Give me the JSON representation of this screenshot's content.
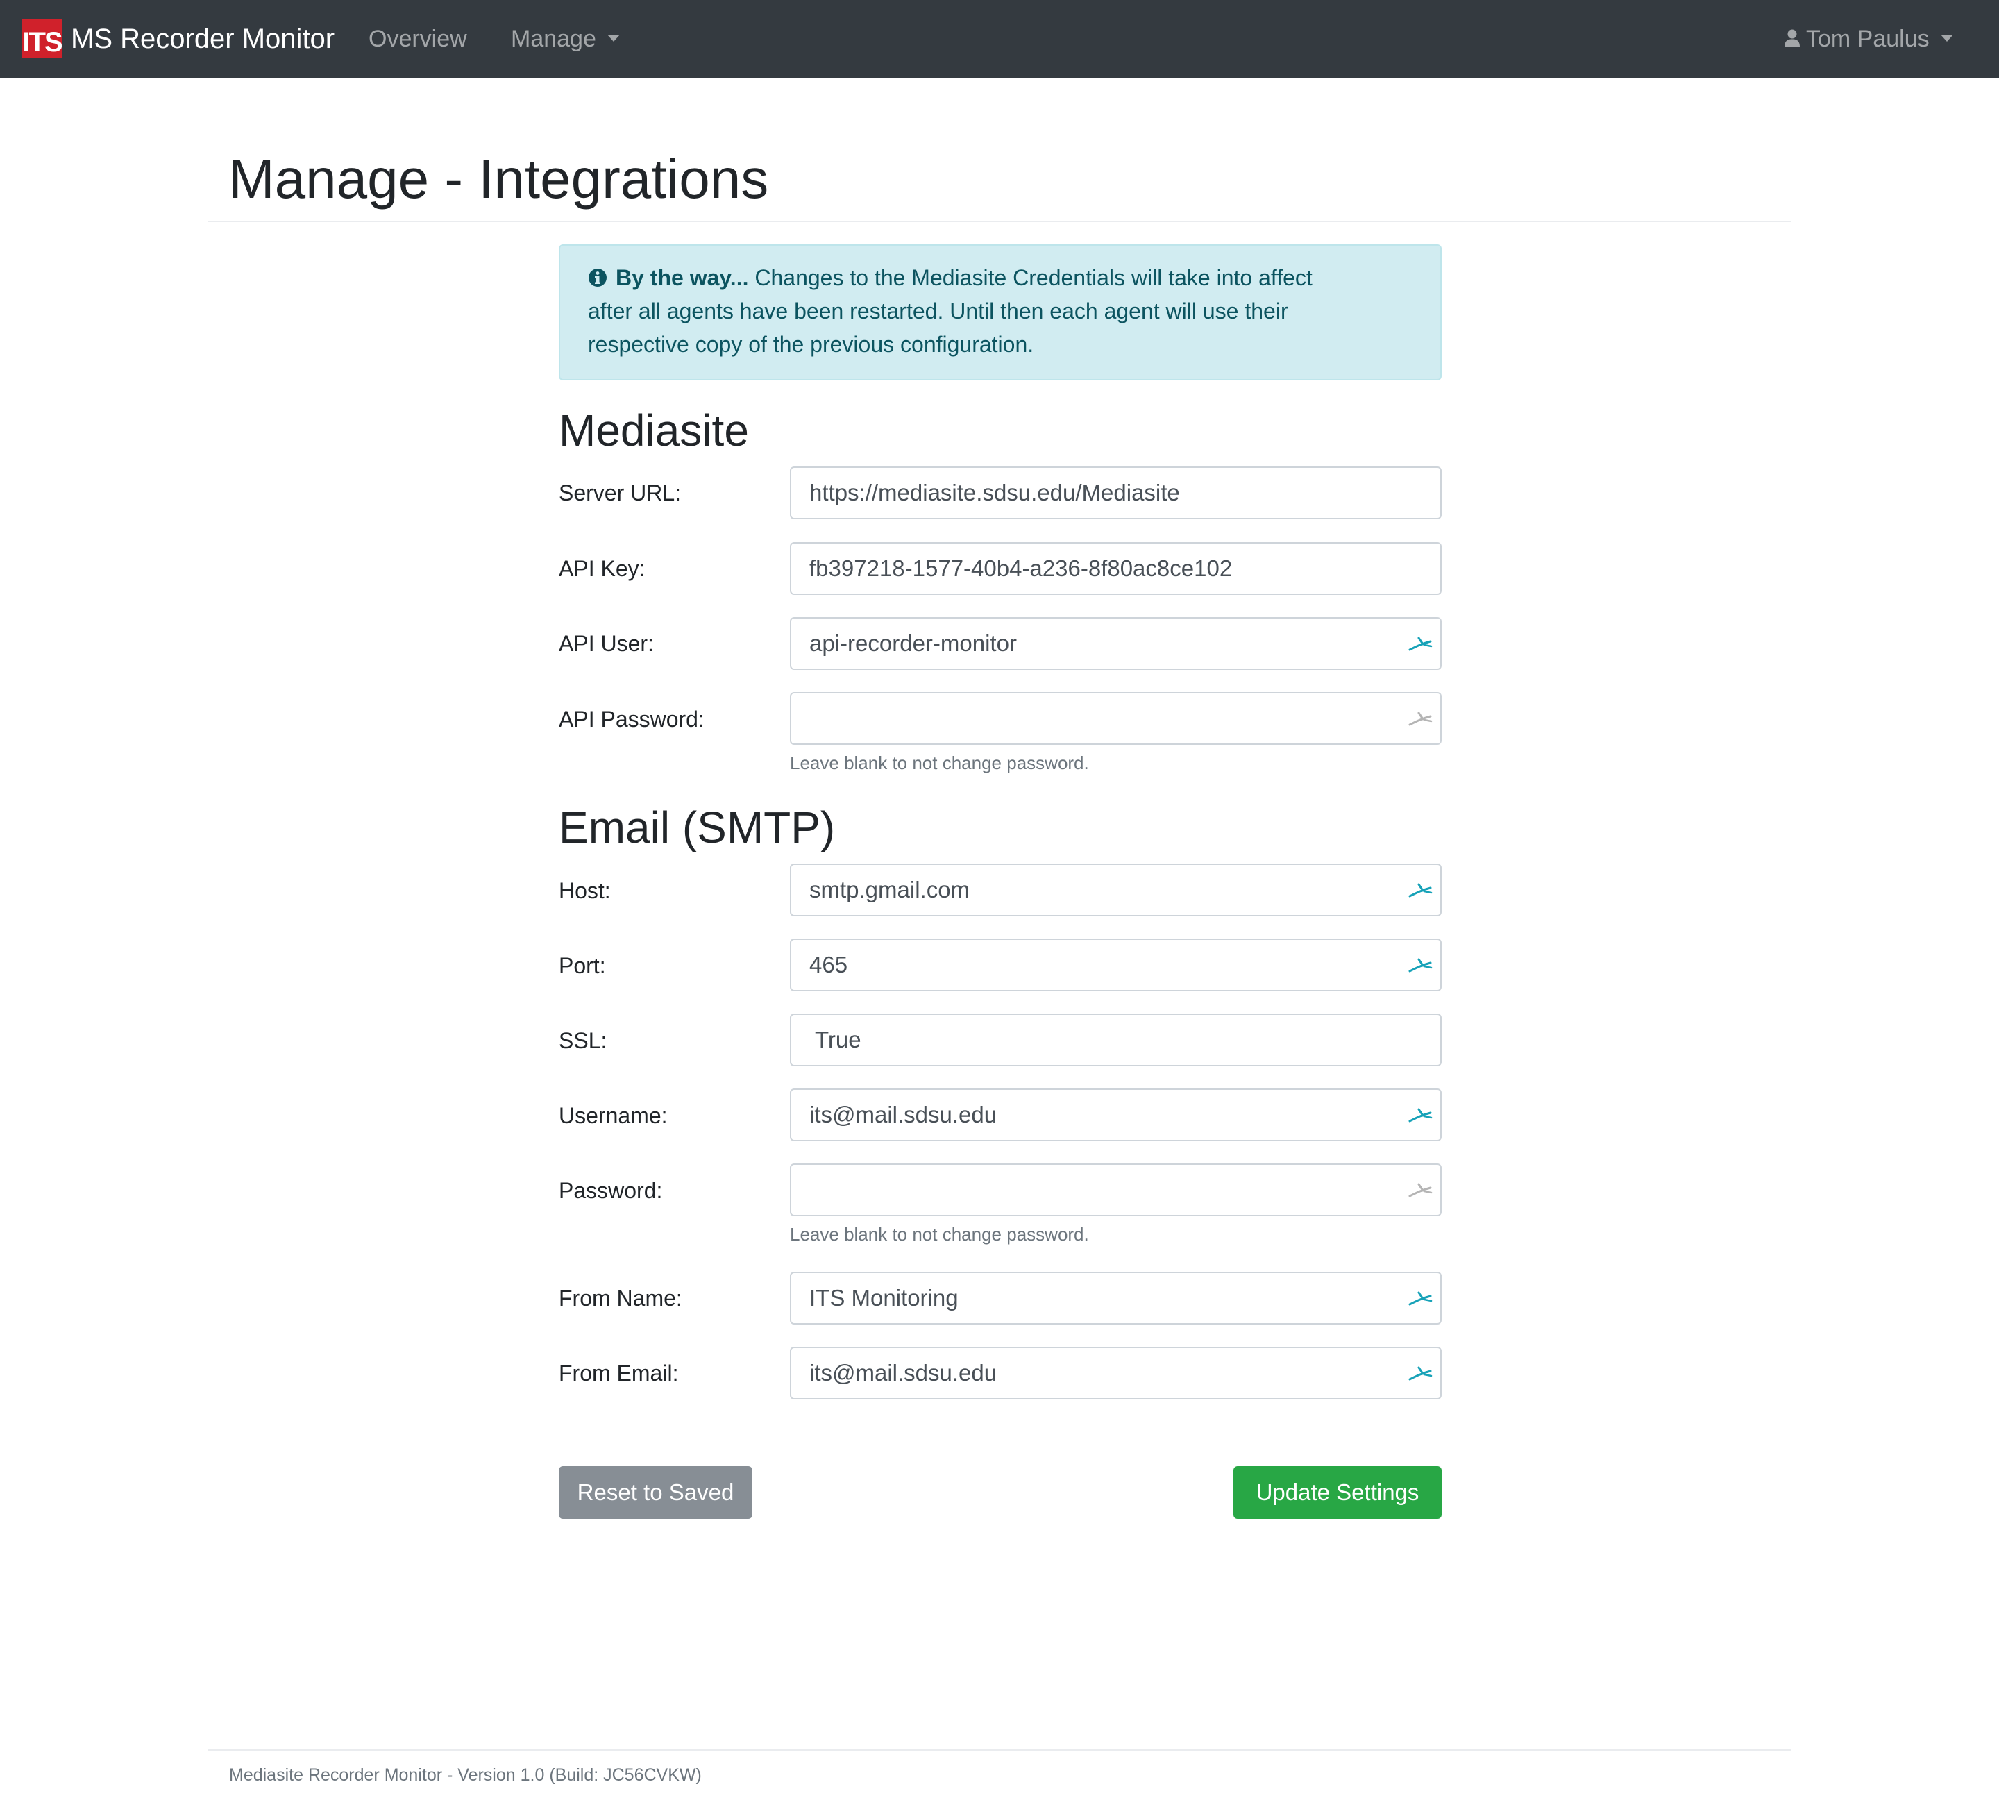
{
  "navbar": {
    "logo_text": "ITS",
    "brand": "MS Recorder Monitor",
    "links": [
      "Overview",
      "Manage"
    ],
    "user": "Tom Paulus"
  },
  "page": {
    "title": "Manage - Integrations"
  },
  "alert": {
    "heading": "By the way...",
    "line1": "Changes to the Mediasite Credentials will take into affect",
    "line2": "after all agents have been restarted. Until then each agent will use their",
    "line3": "respective copy of the previous configuration."
  },
  "mediasite": {
    "title": "Mediasite",
    "fields": [
      {
        "label": "Server URL:",
        "value": "https://mediasite.sdsu.edu/Mediasite"
      },
      {
        "label": "API Key:",
        "value": "fb397218-1577-40b4-a236-8f80ac8ce102"
      },
      {
        "label": "API User:",
        "value": "api-recorder-monitor"
      },
      {
        "label": "API Password:",
        "value": ""
      }
    ],
    "password_help": "Leave blank to not change password."
  },
  "smtp": {
    "title": "Email (SMTP)",
    "fields": [
      {
        "label": "Host:",
        "value": "smtp.gmail.com"
      },
      {
        "label": "Port:",
        "value": "465"
      },
      {
        "label": "SSL:",
        "value": "True"
      },
      {
        "label": "Username:",
        "value": "its@mail.sdsu.edu"
      },
      {
        "label": "Password:",
        "value": ""
      },
      {
        "label": "From Name:",
        "value": "ITS Monitoring"
      },
      {
        "label": "From Email:",
        "value": "its@mail.sdsu.edu"
      }
    ],
    "password_help": "Leave blank to not change password."
  },
  "buttons": {
    "reset": "Reset to Saved",
    "update": "Update Settings"
  },
  "footer": {
    "text": "Mediasite Recorder Monitor - Version 1.0 (Build: JC56CVKW)"
  },
  "colors": {
    "navbar": "#343a40",
    "logo": "#d0212b",
    "alert_bg": "#d1ecf1",
    "alert_text": "#0c5460",
    "success": "#28a745",
    "secondary": "#878e95",
    "autofill_active": "#17a2b8",
    "autofill_inactive": "#b5b5b5"
  }
}
